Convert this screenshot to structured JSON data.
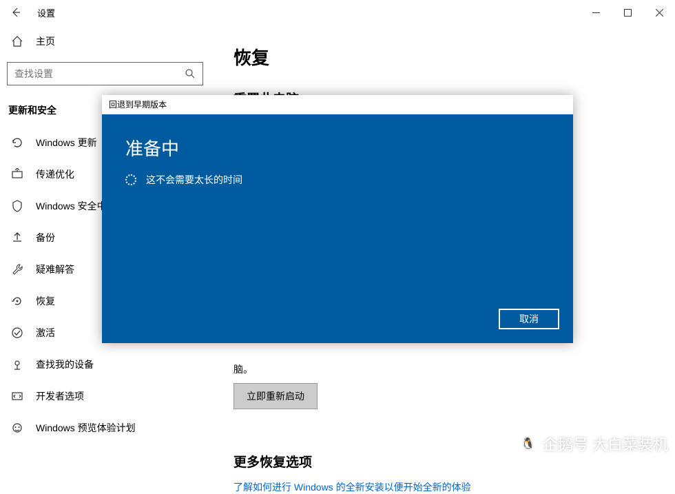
{
  "titlebar": {
    "title": "设置"
  },
  "sidebar": {
    "home": "主页",
    "search_placeholder": "查找设置",
    "section": "更新和安全",
    "items": [
      {
        "label": "Windows 更新"
      },
      {
        "label": "传递优化"
      },
      {
        "label": "Windows 安全中心"
      },
      {
        "label": "备份"
      },
      {
        "label": "疑难解答"
      },
      {
        "label": "恢复"
      },
      {
        "label": "激活"
      },
      {
        "label": "查找我的设备"
      },
      {
        "label": "开发者选项"
      },
      {
        "label": "Windows 预览体验计划"
      }
    ]
  },
  "main": {
    "title": "恢复",
    "reset_title": "重置此电脑",
    "partial_text_suffix": "脑。",
    "restart_button": "立即重新启动",
    "more_title": "更多恢复选项",
    "more_link": "了解如何进行 Windows 的全新安装以便开始全新的体验"
  },
  "dialog": {
    "header": "回退到早期版本",
    "title": "准备中",
    "status": "这不会需要太长的时间",
    "cancel": "取消"
  },
  "watermark": {
    "text": "企鹅号 大白菜装机"
  }
}
